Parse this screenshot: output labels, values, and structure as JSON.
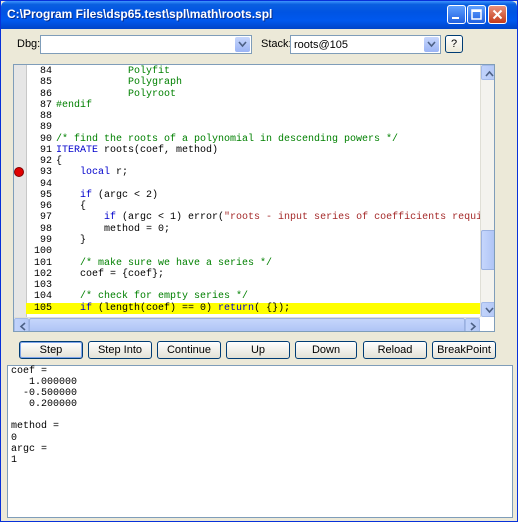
{
  "window": {
    "title": "C:\\Program Files\\dsp65.test\\spl\\math\\roots.spl"
  },
  "toolbar": {
    "dbg_label": "Dbg:",
    "dbg_value": "",
    "stack_label": "Stack:",
    "stack_value": "roots@105",
    "help_label": "?"
  },
  "colors": {
    "comment": "#008000",
    "keyword": "#0000cc",
    "string": "#a52a2a",
    "plain": "#000000",
    "current_line": "#ffff00",
    "breakpoint": "#e00000"
  },
  "editor": {
    "lines": [
      {
        "n": "84",
        "segments": [
          {
            "t": "            Polyfit",
            "c": "comment"
          }
        ]
      },
      {
        "n": "85",
        "segments": [
          {
            "t": "            Polygraph",
            "c": "comment"
          }
        ]
      },
      {
        "n": "86",
        "segments": [
          {
            "t": "            Polyroot",
            "c": "comment"
          }
        ]
      },
      {
        "n": "87",
        "segments": [
          {
            "t": "#endif",
            "c": "comment"
          }
        ]
      },
      {
        "n": "88",
        "segments": []
      },
      {
        "n": "89",
        "segments": []
      },
      {
        "n": "90",
        "segments": [
          {
            "t": "/* find the roots of a polynomial in descending powers */",
            "c": "comment"
          }
        ]
      },
      {
        "n": "91",
        "segments": [
          {
            "t": "ITERATE",
            "c": "keyword"
          },
          {
            "t": " roots(coef, method)",
            "c": "plain"
          }
        ]
      },
      {
        "n": "92",
        "segments": [
          {
            "t": "{",
            "c": "plain"
          }
        ]
      },
      {
        "n": "93",
        "breakpoint": true,
        "segments": [
          {
            "t": "    local",
            "c": "keyword"
          },
          {
            "t": " r;",
            "c": "plain"
          }
        ]
      },
      {
        "n": "94",
        "segments": []
      },
      {
        "n": "95",
        "segments": [
          {
            "t": "    if",
            "c": "keyword"
          },
          {
            "t": " (argc < 2)",
            "c": "plain"
          }
        ]
      },
      {
        "n": "96",
        "segments": [
          {
            "t": "    {",
            "c": "plain"
          }
        ]
      },
      {
        "n": "97",
        "segments": [
          {
            "t": "        if",
            "c": "keyword"
          },
          {
            "t": " (argc < 1) error(",
            "c": "plain"
          },
          {
            "t": "\"roots - input series of coefficients required\"",
            "c": "string"
          },
          {
            "t": ");",
            "c": "plain"
          }
        ]
      },
      {
        "n": "98",
        "segments": [
          {
            "t": "        method = 0;",
            "c": "plain"
          }
        ]
      },
      {
        "n": "99",
        "segments": [
          {
            "t": "    }",
            "c": "plain"
          }
        ]
      },
      {
        "n": "100",
        "segments": []
      },
      {
        "n": "101",
        "segments": [
          {
            "t": "    /* make sure we have a series */",
            "c": "comment"
          }
        ]
      },
      {
        "n": "102",
        "segments": [
          {
            "t": "    coef = {coef};",
            "c": "plain"
          }
        ]
      },
      {
        "n": "103",
        "segments": []
      },
      {
        "n": "104",
        "segments": [
          {
            "t": "    /* check for empty series */",
            "c": "comment"
          }
        ]
      },
      {
        "n": "105",
        "current": true,
        "segments": [
          {
            "t": "    if",
            "c": "keyword"
          },
          {
            "t": " (length(coef) == 0) ",
            "c": "plain"
          },
          {
            "t": "return",
            "c": "keyword"
          },
          {
            "t": "( {});",
            "c": "plain"
          }
        ]
      }
    ]
  },
  "buttons": [
    {
      "id": "step",
      "label": "Step"
    },
    {
      "id": "step-into",
      "label": "Step Into"
    },
    {
      "id": "continue",
      "label": "Continue"
    },
    {
      "id": "up",
      "label": "Up"
    },
    {
      "id": "down",
      "label": "Down"
    },
    {
      "id": "reload",
      "label": "Reload"
    },
    {
      "id": "breakpoint",
      "label": "BreakPoint"
    }
  ],
  "output": {
    "lines": [
      "coef =",
      "   1.000000",
      "  -0.500000",
      "   0.200000",
      "",
      "method =",
      "0",
      "argc =",
      "1"
    ]
  }
}
